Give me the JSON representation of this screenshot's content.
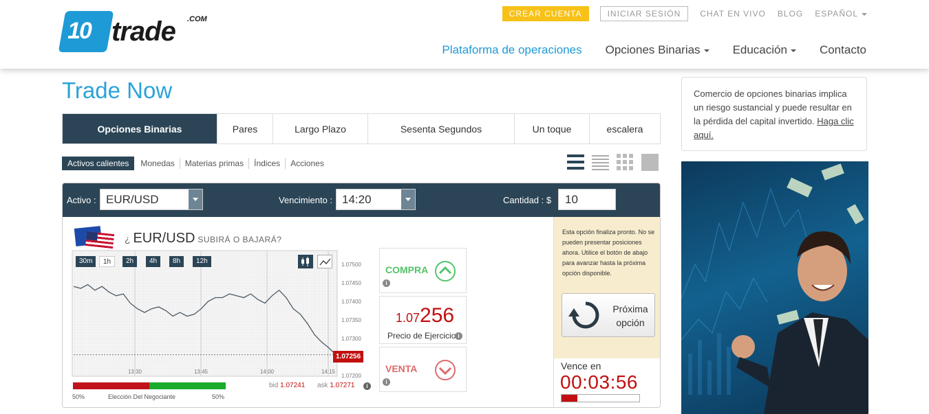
{
  "header": {
    "logo": {
      "number": "10",
      "word": "trade",
      "tld": ".COM"
    },
    "top_links": {
      "create_account": "CREAR CUENTA",
      "login": "INICIAR SESIÓN",
      "live_chat": "CHAT EN VIVO",
      "blog": "BLOG",
      "language": "ESPAÑOL"
    },
    "nav": {
      "platform": "Plataforma de operaciones",
      "binary": "Opciones Binarias",
      "education": "Educación",
      "contact": "Contacto"
    }
  },
  "page_title": "Trade Now",
  "tabs": [
    {
      "label": "Opciones Binarias"
    },
    {
      "label": "Pares"
    },
    {
      "label": "Largo Plazo"
    },
    {
      "label": "Sesenta Segundos"
    },
    {
      "label": "Un toque"
    },
    {
      "label": "escalera"
    }
  ],
  "categories": [
    {
      "label": "Activos calientes"
    },
    {
      "label": "Monedas"
    },
    {
      "label": "Materias primas"
    },
    {
      "label": "Índices"
    },
    {
      "label": "Acciones"
    }
  ],
  "panel": {
    "asset_label": "Activo :",
    "asset_value": "EUR/USD",
    "expiry_label": "Vencimiento :",
    "expiry_value": "14:20",
    "amount_label": "Cantidad : $",
    "amount_value": "10",
    "question_prefix": "¿",
    "question_asset": "EUR/USD",
    "question_suffix": "SUBIRÁ O BAJARÁ?",
    "timeframes": [
      "30m",
      "1h",
      "2h",
      "4h",
      "8h",
      "12h"
    ],
    "buy_label": "COMPRA",
    "sell_label": "VENTA",
    "strike_prefix": "1.07",
    "strike_suffix": "256",
    "strike_label": "Precio de Ejercicio",
    "current_price_tag": "1.07256",
    "bid_label": "bid",
    "bid_value": "1.07241",
    "ask_label": "ask",
    "ask_value": "1.07271",
    "sentiment_left": "50%",
    "sentiment_label": "Elección Del Negociante",
    "sentiment_right": "50%",
    "expiry_note": "Esta opción finaliza pronto. No se pueden presentar posiciones ahora. Utilice el botón de abajo para avanzar hasta la próxima opción disponible.",
    "next_option_label": "Próxima opción",
    "expires_in_label": "Vence en",
    "countdown": "00:03:56",
    "countdown_progress": 0.2
  },
  "chart_data": {
    "type": "line",
    "x_ticks": [
      "13:30",
      "13:45",
      "14:00",
      "14:15"
    ],
    "y_ticks": [
      "1.07500",
      "1.07450",
      "1.07400",
      "1.07350",
      "1.07300",
      "1.07250",
      "1.07200"
    ],
    "ylim": [
      1.072,
      1.0752
    ],
    "series": [
      {
        "values": [
          1.0744,
          1.07435,
          1.07445,
          1.0743,
          1.0744,
          1.07425,
          1.07415,
          1.0742,
          1.07395,
          1.0738,
          1.0737,
          1.0738,
          1.07385,
          1.07375,
          1.0736,
          1.0737,
          1.0736,
          1.07365,
          1.0738,
          1.074,
          1.0741,
          1.0741,
          1.0742,
          1.07415,
          1.0741,
          1.0742,
          1.07405,
          1.07395,
          1.07415,
          1.0743,
          1.0741,
          1.0738,
          1.07365,
          1.0734,
          1.0731,
          1.0729,
          1.07275,
          1.07256
        ]
      }
    ],
    "current_price": 1.07256
  },
  "sidebar": {
    "risk_text": "Comercio de opciones binarias implica un riesgo sustancial y puede resultar en la pérdida del capital invertido.",
    "risk_link": "Haga clic aquí."
  },
  "colors": {
    "brand_blue": "#1e9ad6",
    "dark_navy": "#2b4556",
    "accent_yellow": "#f7c117",
    "price_red": "#c20f0f",
    "buy_green": "#53c46a",
    "sell_red": "#e06a6a"
  }
}
